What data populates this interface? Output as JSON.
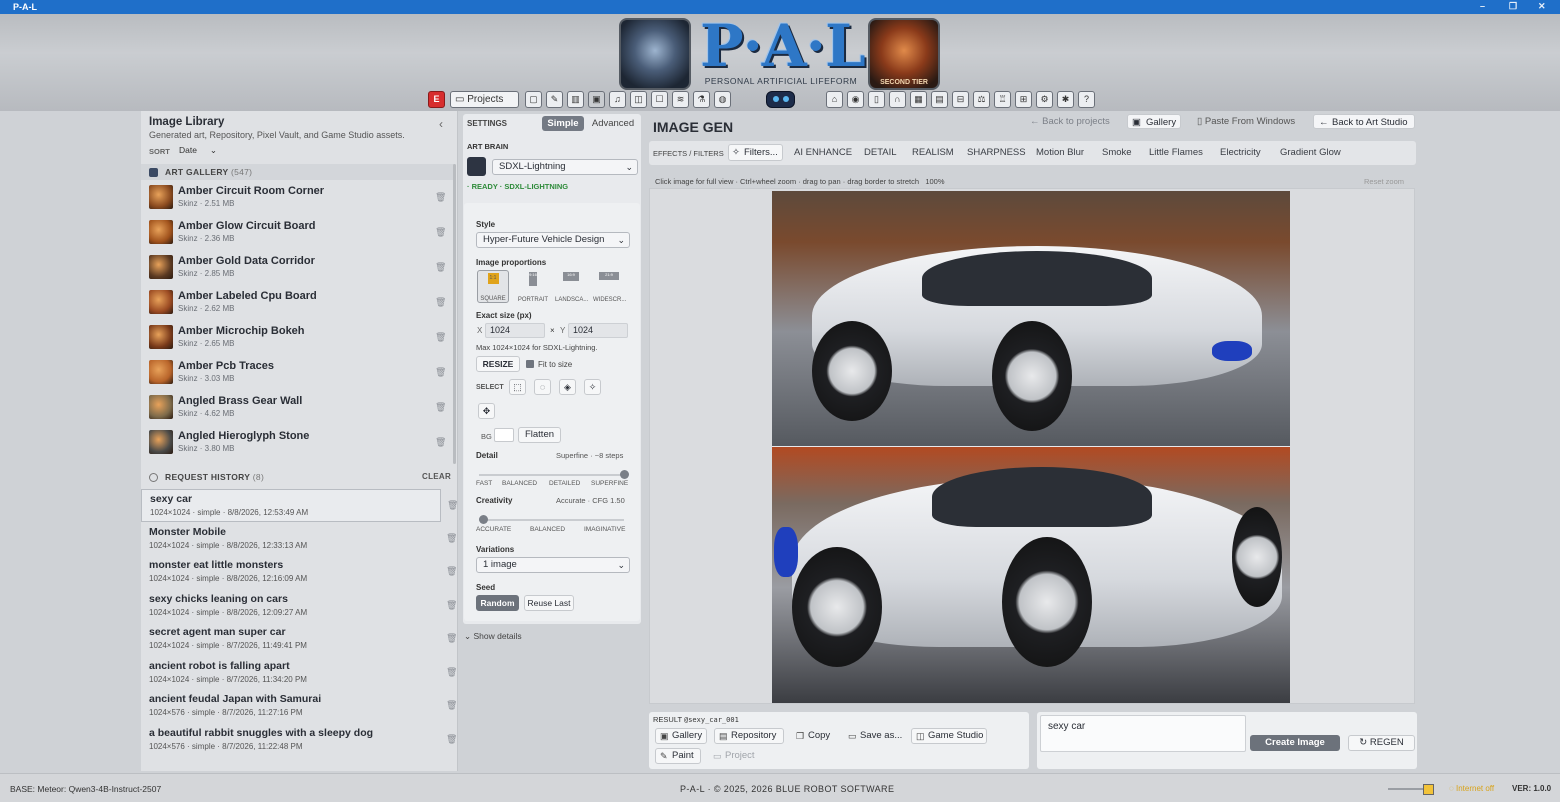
{
  "window": {
    "title": "P-A-L",
    "min": "–",
    "max": "❐",
    "close": "✕"
  },
  "header": {
    "logo": "P·A·L",
    "tagline": "PERSONAL ARTIFICIAL LIFEFORM",
    "badge_right": "SECOND TIER",
    "toolbar": {
      "e_label": "E",
      "projects_label": "Projects"
    }
  },
  "library": {
    "title": "Image Library",
    "subtitle": "Generated art, Repository, Pixel Vault, and Game Studio assets.",
    "sort_label": "SORT",
    "sort_value": "Date",
    "gallery_header": "ART GALLERY",
    "gallery_count": "(547)",
    "items": [
      {
        "name": "Amber Circuit Room Corner",
        "meta": "Skinz · 2.51 MB"
      },
      {
        "name": "Amber Glow Circuit Board",
        "meta": "Skinz · 2.36 MB"
      },
      {
        "name": "Amber Gold Data Corridor",
        "meta": "Skinz · 2.85 MB"
      },
      {
        "name": "Amber Labeled Cpu Board",
        "meta": "Skinz · 2.62 MB"
      },
      {
        "name": "Amber Microchip Bokeh",
        "meta": "Skinz · 2.65 MB"
      },
      {
        "name": "Amber Pcb Traces",
        "meta": "Skinz · 3.03 MB"
      },
      {
        "name": "Angled Brass Gear Wall",
        "meta": "Skinz · 4.62 MB"
      },
      {
        "name": "Angled Hieroglyph Stone",
        "meta": "Skinz · 3.80 MB"
      }
    ],
    "history_header": "REQUEST HISTORY",
    "history_count": "(8)",
    "clear_label": "CLEAR",
    "history": [
      {
        "name": "sexy car",
        "meta": "1024×1024 · simple · 8/8/2026, 12:53:49 AM"
      },
      {
        "name": "Monster Mobile",
        "meta": "1024×1024 · simple · 8/8/2026, 12:33:13 AM"
      },
      {
        "name": "monster eat little monsters",
        "meta": "1024×1024 · simple · 8/8/2026, 12:16:09 AM"
      },
      {
        "name": "sexy chicks leaning on cars",
        "meta": "1024×1024 · simple · 8/8/2026, 12:09:27 AM"
      },
      {
        "name": "secret agent man super car",
        "meta": "1024×1024 · simple · 8/7/2026, 11:49:41 PM"
      },
      {
        "name": "ancient robot is falling apart",
        "meta": "1024×1024 · simple · 8/7/2026, 11:34:20 PM"
      },
      {
        "name": "ancient feudal Japan with Samurai",
        "meta": "1024×576 · simple · 8/7/2026, 11:27:16 PM"
      },
      {
        "name": "a beautiful rabbit snuggles with a sleepy dog",
        "meta": "1024×576 · simple · 8/7/2026, 11:22:48 PM"
      }
    ]
  },
  "settings": {
    "header": "SETTINGS",
    "tab_simple": "Simple",
    "tab_advanced": "Advanced",
    "art_brain_label": "ART BRAIN",
    "model": "SDXL-Lightning",
    "status": "· READY · SDXL-LIGHTNING",
    "style_label": "Style",
    "style_value": "Hyper-Future Vehicle Design",
    "proportions_label": "Image proportions",
    "proportions": [
      {
        "ratio": "1:1",
        "label": "SQUARE"
      },
      {
        "ratio": "9:16",
        "label": "PORTRAIT"
      },
      {
        "ratio": "16:9",
        "label": "LANDSCA..."
      },
      {
        "ratio": "21:9",
        "label": "WIDESCR..."
      }
    ],
    "exact_size_label": "Exact size (px)",
    "x_label": "X",
    "x_value": "1024",
    "times": "×",
    "y_label": "Y",
    "y_value": "1024",
    "max_note": "Max 1024×1024 for SDXL-Lightning.",
    "resize_label": "RESIZE",
    "fit_label": "Fit to size",
    "select_label": "SELECT",
    "bg_label": "BG",
    "flatten_label": "Flatten",
    "detail_label": "Detail",
    "detail_value": "Superfine · ~8 steps",
    "detail_ticks": [
      "FAST",
      "BALANCED",
      "DETAILED",
      "SUPERFINE"
    ],
    "detail_level": 1.0,
    "creativity_label": "Creativity",
    "creativity_value": "Accurate · CFG 1.50",
    "creativity_ticks": [
      "ACCURATE",
      "BALANCED",
      "IMAGINATIVE"
    ],
    "creativity_level": 0.0,
    "variations_label": "Variations",
    "variations_value": "1 image",
    "seed_label": "Seed",
    "seed_random": "Random",
    "seed_reuse": "Reuse Last",
    "show_details": "Show details"
  },
  "main": {
    "title": "IMAGE GEN",
    "back_projects": "Back to projects",
    "gallery": "Gallery",
    "paste": "Paste From Windows",
    "back_art": "Back to Art Studio",
    "effects_label": "EFFECTS / FILTERS",
    "filters_btn": "Filters...",
    "effects": [
      "AI ENHANCE",
      "DETAIL",
      "REALISM",
      "SHARPNESS",
      "Motion Blur",
      "Smoke",
      "Little Flames",
      "Electricity",
      "Gradient Glow"
    ],
    "hint": "Click image for full view · Ctrl+wheel zoom · drag to pan · drag border to stretch",
    "zoom": "100%",
    "reset_zoom": "Reset zoom"
  },
  "result": {
    "label": "RESULT",
    "name": "@sexy_car_001",
    "buttons": [
      "Gallery",
      "Repository",
      "Copy",
      "Save as...",
      "Game Studio"
    ],
    "paint": "Paint",
    "project": "Project"
  },
  "prompt": {
    "text": "sexy car",
    "create": "Create Image",
    "regen": "REGEN"
  },
  "footer": {
    "base": "BASE: Meteor: Qwen3-4B-Instruct-2507",
    "center": "P-A-L · © 2025, 2026 BLUE ROBOT SOFTWARE",
    "internet": "Internet off",
    "version": "VER: 1.0.0"
  }
}
